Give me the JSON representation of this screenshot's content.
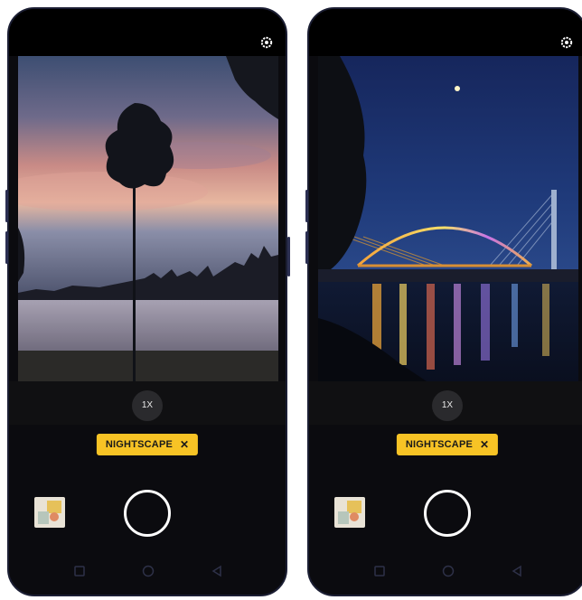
{
  "phones": [
    {
      "id": "left",
      "zoom_label": "1X",
      "mode_label": "NIGHTSCAPE",
      "close_glyph": "✕",
      "scene": "sunset"
    },
    {
      "id": "right",
      "zoom_label": "1X",
      "mode_label": "NIGHTSCAPE",
      "close_glyph": "✕",
      "scene": "bridge"
    }
  ],
  "colors": {
    "mode_pill": "#f7c325",
    "frame": "#1b1e33",
    "body": "#0b0b0f"
  },
  "icons": {
    "settings": "gear-icon",
    "recent": "square-icon",
    "home": "circle-icon",
    "back": "triangle-back-icon"
  }
}
